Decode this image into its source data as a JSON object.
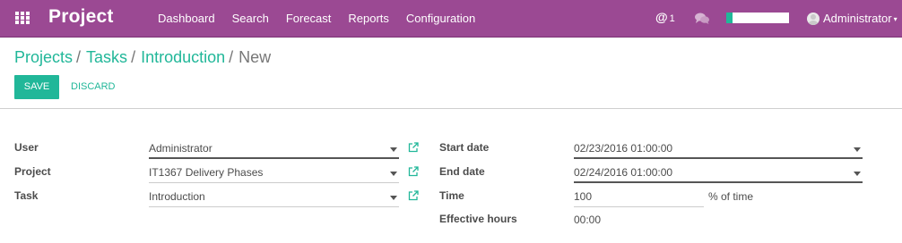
{
  "navbar": {
    "app_title": "Project",
    "menu": [
      "Dashboard",
      "Search",
      "Forecast",
      "Reports",
      "Configuration"
    ],
    "mention_symbol": "@",
    "mention_count": "1",
    "progress_fraction": 0.1,
    "user_name": "Administrator",
    "brand_color": "#9b4993",
    "accent_color": "#21b799"
  },
  "breadcrumb": {
    "items": [
      "Projects",
      "Tasks",
      "Introduction"
    ],
    "separator": "/",
    "current": "New"
  },
  "buttons": {
    "save": "SAVE",
    "discard": "DISCARD"
  },
  "form": {
    "left": [
      {
        "label": "User",
        "value": "Administrator"
      },
      {
        "label": "Project",
        "value": "IT1367 Delivery Phases"
      },
      {
        "label": "Task",
        "value": "Introduction"
      }
    ],
    "right": {
      "start_label": "Start date",
      "start_value": "02/23/2016 01:00:00",
      "end_label": "End date",
      "end_value": "02/24/2016 01:00:00",
      "time_label": "Time",
      "time_value": "100",
      "time_unit": "% of time",
      "effective_label": "Effective hours",
      "effective_value": "00:00"
    }
  },
  "icons": {
    "apps": "grid-icon",
    "chat": "chat-bubbles-icon",
    "external": "external-link-icon",
    "dropdown": "caret-down-icon",
    "avatar": "user-avatar-icon"
  }
}
